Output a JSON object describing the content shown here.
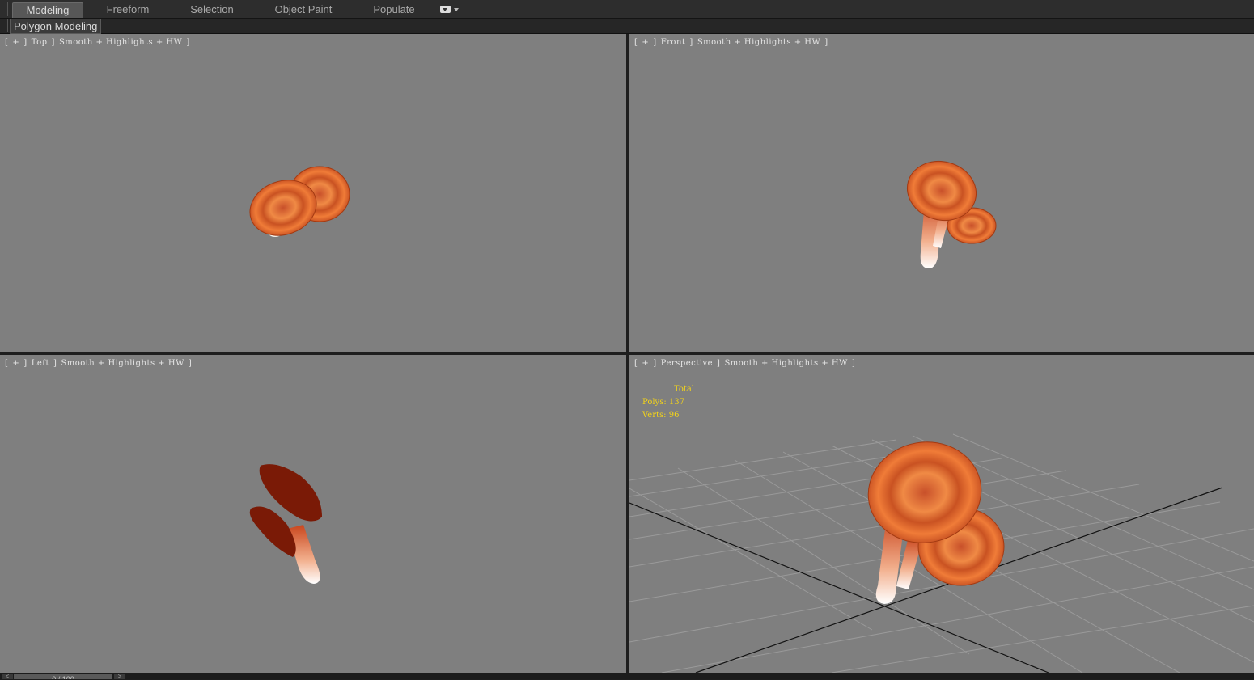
{
  "ribbon": {
    "tabs": [
      {
        "label": "Modeling",
        "active": true
      },
      {
        "label": "Freeform",
        "active": false
      },
      {
        "label": "Selection",
        "active": false
      },
      {
        "label": "Object Paint",
        "active": false
      },
      {
        "label": "Populate",
        "active": false
      }
    ],
    "menu_icon": "dropdown-menu-icon"
  },
  "panel": {
    "label": "Polygon Modeling"
  },
  "viewports": [
    {
      "id": "top",
      "menu": "+",
      "view": "Top",
      "shading": "Smooth + Highlights + HW"
    },
    {
      "id": "front",
      "menu": "+",
      "view": "Front",
      "shading": "Smooth + Highlights + HW"
    },
    {
      "id": "left",
      "menu": "+",
      "view": "Left",
      "shading": "Smooth + Highlights + HW"
    },
    {
      "id": "perspective",
      "menu": "+",
      "view": "Perspective",
      "shading": "Smooth + Highlights + HW"
    }
  ],
  "stats": {
    "total": "Total",
    "polys": "Polys: 137",
    "verts": "Verts: 96"
  },
  "timeline": {
    "frame": "0 / 100",
    "prev": "<",
    "next": ">"
  },
  "colors": {
    "viewport_bg": "#7f7f7f",
    "cap_orange": "#e0672a",
    "cap_dark": "#7a1a06",
    "stem_white": "#ffffff",
    "stats_yellow": "#f2d21a"
  }
}
